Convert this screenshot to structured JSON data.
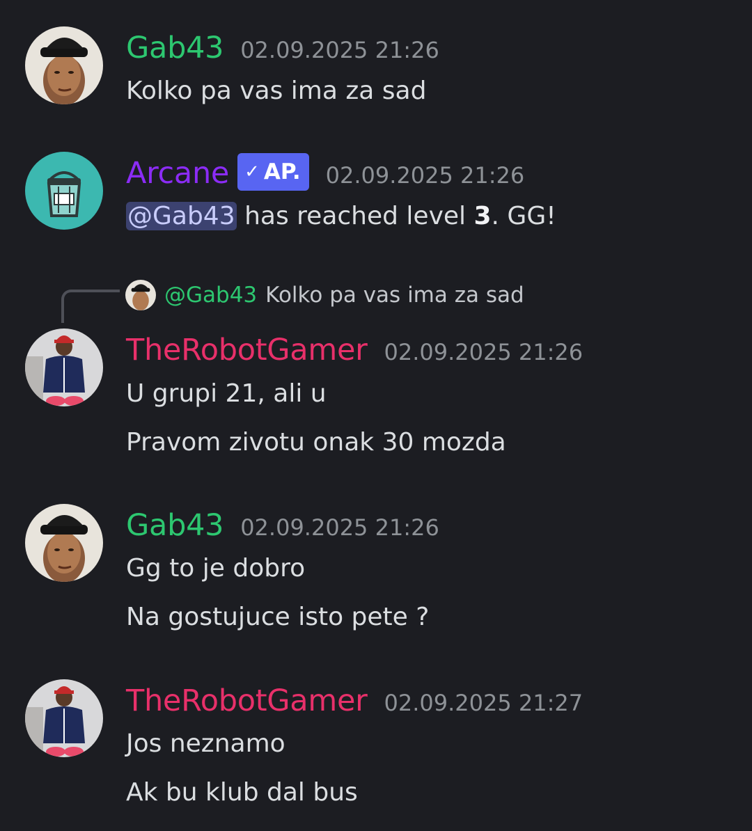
{
  "messages": [
    {
      "username": "Gab43",
      "name_color": "#2dc770",
      "avatar": "man-in-black-hat-avatar",
      "timestamp": "02.09.2025 21:26",
      "lines": [
        "Kolko pa vas ima za sad"
      ]
    },
    {
      "username": "Arcane",
      "name_color": "#8b2cf5",
      "avatar": "teal-bucket-bot-avatar",
      "badge": "AP.",
      "timestamp": "02.09.2025 21:26",
      "mention": "@Gab43",
      "text_before_level": "has reached level",
      "level": "3",
      "text_after_level": ". GG!"
    },
    {
      "username": "TheRobotGamer",
      "name_color": "#e8306a",
      "avatar": "man-in-tracksuit-avatar",
      "timestamp": "02.09.2025 21:26",
      "reply": {
        "username": "@Gab43",
        "text": "Kolko pa vas ima za sad"
      },
      "lines": [
        "U grupi 21, ali u",
        "Pravom zivotu onak 30 mozda"
      ]
    },
    {
      "username": "Gab43",
      "name_color": "#2dc770",
      "avatar": "man-in-black-hat-avatar",
      "timestamp": "02.09.2025 21:26",
      "lines": [
        "Gg to je dobro",
        "Na gostujuce isto pete ?"
      ]
    },
    {
      "username": "TheRobotGamer",
      "name_color": "#e8306a",
      "avatar": "man-in-tracksuit-avatar",
      "timestamp": "02.09.2025 21:27",
      "lines": [
        "Jos neznamo",
        "Ak bu klub dal bus"
      ]
    }
  ]
}
